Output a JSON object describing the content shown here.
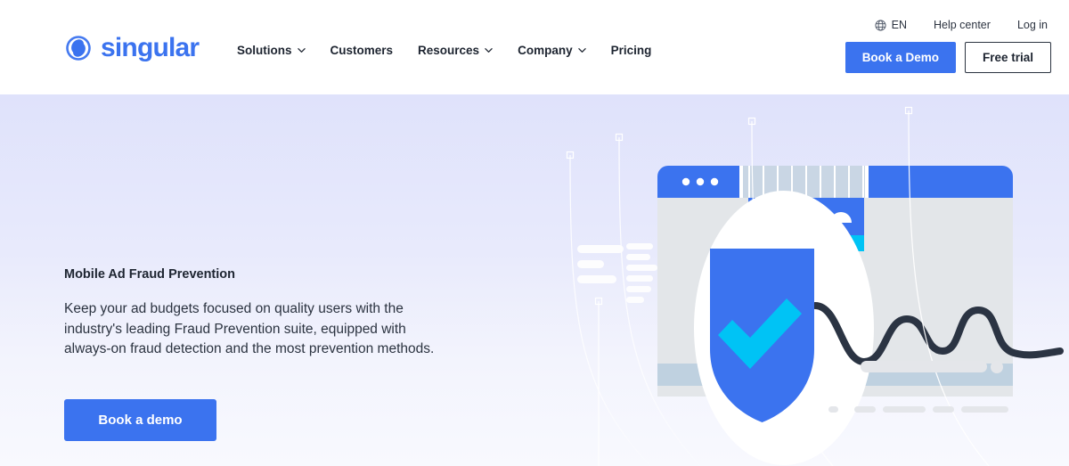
{
  "brand": {
    "name": "singular",
    "logo_icon": "singular-swirl-logo",
    "accent": "#3b73ef",
    "cyan": "#00c3f5",
    "dark": "#2b3443"
  },
  "header": {
    "nav": [
      {
        "label": "Solutions",
        "has_dropdown": true,
        "icon": "chevron-down-icon"
      },
      {
        "label": "Customers",
        "has_dropdown": false,
        "icon": ""
      },
      {
        "label": "Resources",
        "has_dropdown": true,
        "icon": "chevron-down-icon"
      },
      {
        "label": "Company",
        "has_dropdown": true,
        "icon": "chevron-down-icon"
      },
      {
        "label": "Pricing",
        "has_dropdown": false,
        "icon": ""
      }
    ],
    "util": {
      "lang_icon": "globe-icon",
      "lang": "EN",
      "help": "Help center",
      "login": "Log in"
    },
    "cta": {
      "demo": "Book a Demo",
      "trial": "Free trial"
    }
  },
  "hero": {
    "eyebrow": "Mobile Ad Fraud Prevention",
    "body": "Keep your ad budgets focused on quality users with the industry's leading Fraud Prevention suite, equipped with always-on fraud detection and the most prevention methods.",
    "cta": "Book a demo",
    "background_top": "#dfe2fb",
    "background_bottom": "#f8f9fe",
    "illustration": {
      "name": "fraud-prevention-shield-dashboard",
      "elements": [
        "browser-window",
        "window-dots",
        "shield-icon",
        "checkmark-icon",
        "white-ellipse",
        "wavy-line-chart",
        "vertical-guide-lines",
        "square-markers",
        "placeholder-bars"
      ]
    }
  }
}
